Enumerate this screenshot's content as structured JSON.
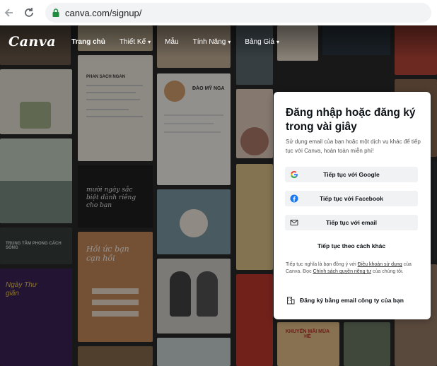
{
  "browser": {
    "url": "canva.com/signup/"
  },
  "nav": {
    "logo": "Canva",
    "items": [
      {
        "label": "Trang chủ",
        "dropdown": false
      },
      {
        "label": "Thiết Kế",
        "dropdown": true
      },
      {
        "label": "Mẫu",
        "dropdown": false
      },
      {
        "label": "Tính Năng",
        "dropdown": true
      },
      {
        "label": "Bảng Giá",
        "dropdown": true
      }
    ]
  },
  "login": {
    "title": "Đăng nhập hoặc đăng ký trong vài giây",
    "subtitle": "Sử dụng email của bạn hoặc một dịch vụ khác để tiếp tục với Canva, hoàn toàn miễn phí!",
    "buttons": {
      "google": "Tiếp tục với Google",
      "facebook": "Tiếp tục với Facebook",
      "email": "Tiếp tục với email"
    },
    "other": "Tiếp tục theo cách khác",
    "legal": {
      "pre": "Tiếp tục nghĩa là bạn đồng ý với ",
      "terms": "Điều khoản sử dụng",
      "mid": " của Canva. Đọc ",
      "privacy": "Chính sách quyền riêng tư",
      "post": " của chúng tôi."
    },
    "business": "Đăng ký bằng email công ty của bạn"
  },
  "background_text": {
    "tile1": "PHAN SACH NGAN",
    "tile2": "ĐÀO MỸ NGA",
    "tile3": "mười ngày sắc biệt dành riêng cho bạn",
    "tile4": "Hồi ức bạn cạn hồi",
    "tile5": "KHUYẾN MÃI MÙA HÈ",
    "tile6": "Ngày Thư giãn",
    "tile7": "TRUNG TÂM PHONG CÁCH SỐNG"
  },
  "colors": {
    "brand": "#00c4cc",
    "google_blue": "#4285f4",
    "facebook": "#1877f2"
  }
}
